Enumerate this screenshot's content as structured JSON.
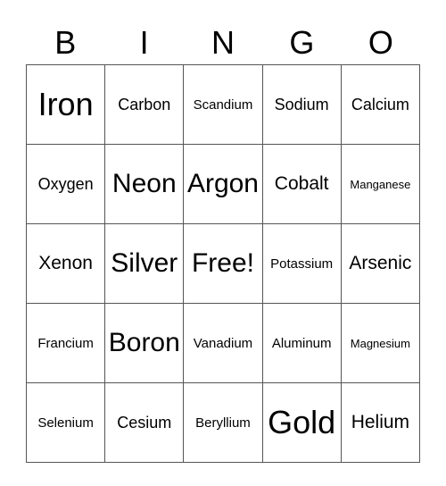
{
  "header": [
    "B",
    "I",
    "N",
    "G",
    "O"
  ],
  "rows": [
    [
      "Iron",
      "Carbon",
      "Scandium",
      "Sodium",
      "Calcium"
    ],
    [
      "Oxygen",
      "Neon",
      "Argon",
      "Cobalt",
      "Manganese"
    ],
    [
      "Xenon",
      "Silver",
      "Free!",
      "Potassium",
      "Arsenic"
    ],
    [
      "Francium",
      "Boron",
      "Vanadium",
      "Aluminum",
      "Magnesium"
    ],
    [
      "Selenium",
      "Cesium",
      "Beryllium",
      "Gold",
      "Helium"
    ]
  ]
}
